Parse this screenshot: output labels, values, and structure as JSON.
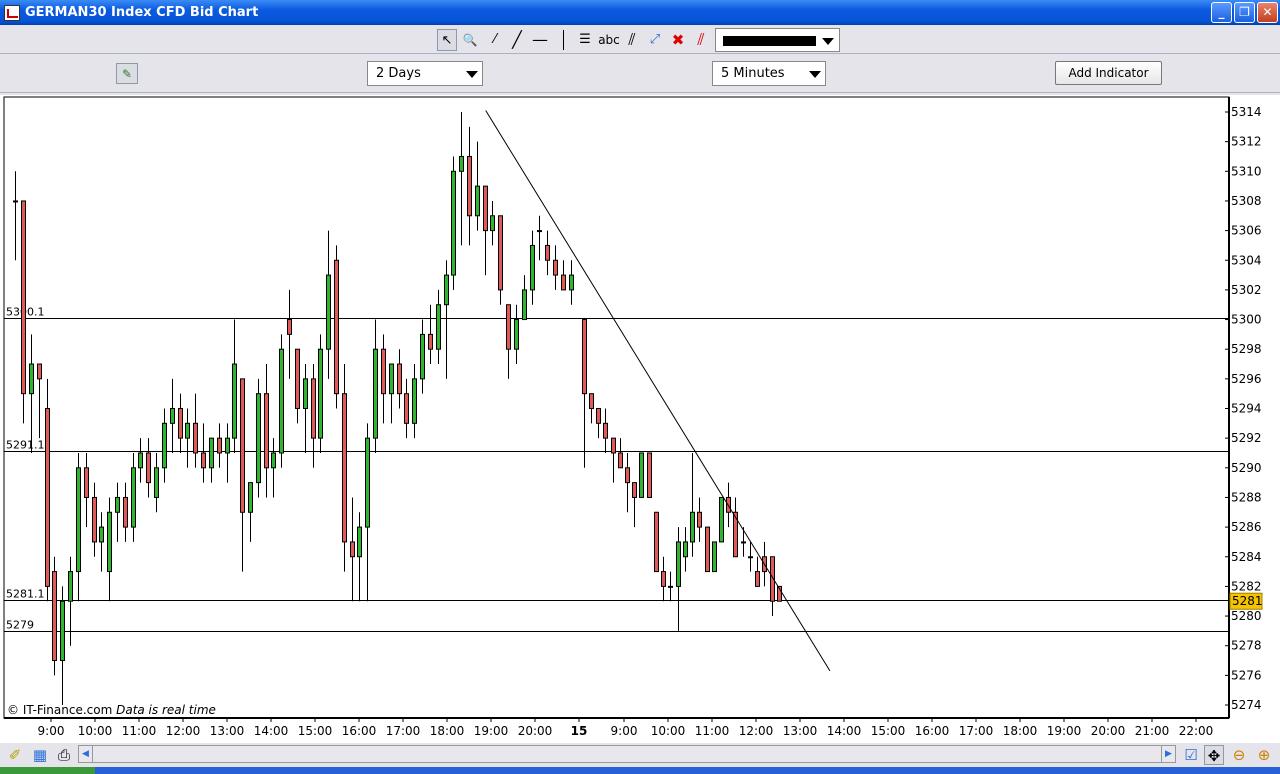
{
  "window": {
    "title": "GERMAN30 Index CFD Bid Chart",
    "minimize": "_",
    "maximize": "❐",
    "close": "✕"
  },
  "toolbar": {
    "tools": [
      {
        "name": "pointer-icon",
        "glyph": "↖"
      },
      {
        "name": "zoom-icon",
        "glyph": "🔍"
      },
      {
        "name": "short-line-icon",
        "glyph": "⁄"
      },
      {
        "name": "trend-line-icon",
        "glyph": "╱"
      },
      {
        "name": "horizontal-line-icon",
        "glyph": "—"
      },
      {
        "name": "fibonacci-icon",
        "glyph": "☰"
      },
      {
        "name": "text-tool-icon",
        "glyph": "abc"
      },
      {
        "name": "parallel-lines-icon",
        "glyph": "⫽"
      },
      {
        "name": "extend-line-icon",
        "glyph": "⤢"
      },
      {
        "name": "delete-icon",
        "glyph": "✖"
      },
      {
        "name": "delete-all-lines-icon",
        "glyph": "⫽"
      }
    ],
    "line_color": "#000000"
  },
  "controls": {
    "period": "2 Days",
    "interval": "5 Minutes",
    "add_indicator": "Add Indicator"
  },
  "chart_data": {
    "type": "candlestick",
    "title": "GERMAN30 Index CFD Bid Chart",
    "ylim": [
      5273,
      5315
    ],
    "yticks": [
      5274,
      5276,
      5278,
      5280,
      5282,
      5284,
      5286,
      5288,
      5290,
      5292,
      5294,
      5296,
      5298,
      5300,
      5302,
      5304,
      5306,
      5308,
      5310,
      5312,
      5314
    ],
    "xticks_day1": [
      "9:00",
      "10:00",
      "11:00",
      "12:00",
      "13:00",
      "14:00",
      "15:00",
      "16:00",
      "17:00",
      "18:00",
      "19:00",
      "20:00"
    ],
    "day_label": "15",
    "xticks_day2": [
      "9:00",
      "10:00",
      "11:00",
      "12:00",
      "13:00",
      "14:00",
      "15:00",
      "16:00",
      "17:00",
      "18:00",
      "19:00",
      "20:00",
      "21:00",
      "22:00"
    ],
    "current_price": "5281",
    "colors": {
      "up": "#2fb52f",
      "down": "#e05a5a",
      "current": "#f5c400"
    },
    "hlines": [
      {
        "label": "5300.1",
        "price": 5300.1
      },
      {
        "label": "5291.1",
        "price": 5291.1
      },
      {
        "label": "5281.1",
        "price": 5281.1
      },
      {
        "label": "5279",
        "price": 5279
      }
    ],
    "trendline": {
      "from": {
        "day": 1,
        "time": 18.88,
        "price": 5314.1
      },
      "to": {
        "day": 2,
        "time": 13.68,
        "price": 5276.3
      }
    },
    "watermark": "© IT-Finance.com",
    "watermark_note": "Data is real time",
    "sessions": [
      {
        "day": 1,
        "start": 8.1,
        "end": 20.9,
        "ohlc": [
          [
            5308,
            5310,
            5304,
            5308
          ],
          [
            5308,
            5308,
            5293,
            5295
          ],
          [
            5295,
            5299,
            5291,
            5297
          ],
          [
            5297,
            5297,
            5292,
            5296
          ],
          [
            5294,
            5296,
            5281,
            5282
          ],
          [
            5283,
            5284,
            5276,
            5277
          ],
          [
            5277,
            5282,
            5274,
            5281
          ],
          [
            5281,
            5284,
            5278,
            5283
          ],
          [
            5283,
            5291,
            5281,
            5290
          ],
          [
            5290,
            5291,
            5286,
            5288
          ],
          [
            5288,
            5289,
            5284,
            5285
          ],
          [
            5285,
            5287,
            5283,
            5286
          ],
          [
            5283,
            5288,
            5281,
            5287
          ],
          [
            5287,
            5289,
            5285,
            5288
          ],
          [
            5288,
            5289,
            5285,
            5286
          ],
          [
            5286,
            5291,
            5285,
            5290
          ],
          [
            5290,
            5292,
            5289,
            5291
          ],
          [
            5291,
            5292,
            5288,
            5289
          ],
          [
            5288,
            5291,
            5287,
            5290
          ],
          [
            5290,
            5294,
            5289,
            5293
          ],
          [
            5293,
            5296,
            5291,
            5294
          ],
          [
            5294,
            5295,
            5291,
            5292
          ],
          [
            5292,
            5294,
            5290,
            5293
          ],
          [
            5293,
            5295,
            5290,
            5291
          ],
          [
            5291,
            5293,
            5289,
            5290
          ],
          [
            5290,
            5292,
            5289,
            5292
          ],
          [
            5292,
            5293,
            5290,
            5291
          ],
          [
            5291,
            5293,
            5289,
            5292
          ],
          [
            5292,
            5300,
            5291,
            5297
          ],
          [
            5296,
            5296,
            5283,
            5287
          ],
          [
            5287,
            5289,
            5285,
            5289
          ],
          [
            5289,
            5296,
            5288,
            5295
          ],
          [
            5295,
            5297,
            5288,
            5290
          ],
          [
            5290,
            5292,
            5288,
            5291
          ],
          [
            5291,
            5299,
            5290,
            5298
          ],
          [
            5300,
            5302,
            5296,
            5299
          ],
          [
            5298,
            5298,
            5293,
            5294
          ],
          [
            5294,
            5297,
            5291,
            5296
          ],
          [
            5296,
            5297,
            5290,
            5292
          ],
          [
            5292,
            5299,
            5291,
            5298
          ],
          [
            5298,
            5306,
            5296,
            5303
          ],
          [
            5304,
            5305,
            5294,
            5295
          ],
          [
            5295,
            5297,
            5283,
            5285
          ],
          [
            5285,
            5288,
            5281,
            5284
          ],
          [
            5284,
            5287,
            5281,
            5286
          ],
          [
            5286,
            5293,
            5281,
            5292
          ],
          [
            5292,
            5300,
            5291,
            5298
          ],
          [
            5298,
            5299,
            5293,
            5295
          ],
          [
            5295,
            5297,
            5293,
            5297
          ],
          [
            5297,
            5298,
            5294,
            5295
          ],
          [
            5295,
            5296,
            5292,
            5293
          ],
          [
            5293,
            5297,
            5292,
            5296
          ],
          [
            5296,
            5300,
            5295,
            5299
          ],
          [
            5299,
            5301,
            5297,
            5298
          ],
          [
            5298,
            5302,
            5297,
            5301
          ],
          [
            5301,
            5304,
            5296,
            5303
          ],
          [
            5303,
            5311,
            5302,
            5310
          ],
          [
            5310,
            5314,
            5305,
            5311
          ],
          [
            5311,
            5313,
            5305,
            5307
          ],
          [
            5307,
            5312,
            5306,
            5309
          ],
          [
            5309,
            5309,
            5303,
            5306
          ],
          [
            5306,
            5308,
            5305,
            5307
          ],
          [
            5307,
            5307,
            5301,
            5302
          ],
          [
            5301,
            5301,
            5296,
            5298
          ],
          [
            5298,
            5301,
            5297,
            5300
          ],
          [
            5300,
            5303,
            5300,
            5302
          ],
          [
            5302,
            5306,
            5301,
            5305
          ],
          [
            5306,
            5307,
            5304,
            5306
          ],
          [
            5305,
            5306,
            5303,
            5304
          ],
          [
            5304,
            5305,
            5302,
            5303
          ],
          [
            5303,
            5304,
            5302,
            5302
          ],
          [
            5302,
            5304,
            5301,
            5303
          ]
        ]
      },
      {
        "day": 2,
        "start": 8.0,
        "end": 12.6,
        "ohlc": [
          [
            5300,
            5300,
            5290,
            5295
          ],
          [
            5295,
            5295,
            5293,
            5294
          ],
          [
            5294,
            5294,
            5292,
            5293
          ],
          [
            5293,
            5294,
            5291,
            5292
          ],
          [
            5292,
            5292,
            5289,
            5291
          ],
          [
            5291,
            5292,
            5290,
            5290
          ],
          [
            5290,
            5291,
            5287,
            5289
          ],
          [
            5289,
            5289,
            5286,
            5288
          ],
          [
            5288,
            5291,
            5288,
            5291
          ],
          [
            5291,
            5291,
            5288,
            5288
          ],
          [
            5287,
            5287,
            5283,
            5283
          ],
          [
            5283,
            5284,
            5281,
            5282
          ],
          [
            5282,
            5283,
            5281,
            5282
          ],
          [
            5282,
            5286,
            5279,
            5285
          ],
          [
            5284,
            5286,
            5283,
            5285
          ],
          [
            5285,
            5291,
            5284,
            5287
          ],
          [
            5287,
            5288,
            5285,
            5286
          ],
          [
            5286,
            5286,
            5283,
            5283
          ],
          [
            5283,
            5285,
            5283,
            5285
          ],
          [
            5285,
            5288,
            5285,
            5288
          ],
          [
            5288,
            5289,
            5286,
            5287
          ],
          [
            5287,
            5288,
            5284,
            5284
          ],
          [
            5285,
            5286,
            5284,
            5285
          ],
          [
            5284,
            5285,
            5283,
            5284
          ],
          [
            5283,
            5284,
            5282,
            5282
          ],
          [
            5284,
            5285,
            5282,
            5283
          ],
          [
            5284,
            5284,
            5280,
            5281
          ],
          [
            5282,
            5282,
            5281,
            5281
          ]
        ]
      }
    ]
  },
  "bottom": {
    "tools": [
      "paint-brush-icon",
      "properties-icon",
      "print-icon"
    ],
    "right_tools": [
      "snapshot-icon",
      "pan-icon",
      "zoom-out-icon",
      "zoom-in-icon"
    ]
  }
}
